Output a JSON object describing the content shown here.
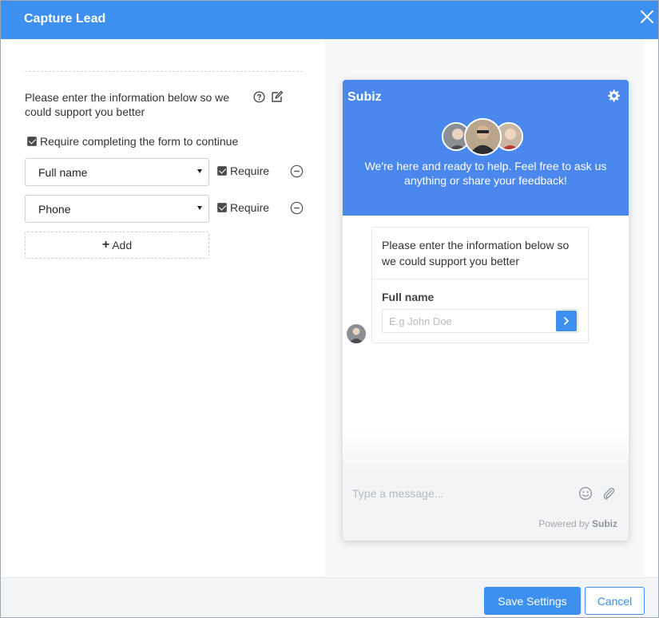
{
  "dialog": {
    "title": "Capture Lead",
    "close_icon": "close-icon"
  },
  "form": {
    "intro": "Please enter the information below so we could support you better",
    "require_label": "Require completing the form to continue",
    "require_checked": true,
    "fields": [
      {
        "value": "Full name",
        "require_label": "Require",
        "require_checked": true
      },
      {
        "value": "Phone",
        "require_label": "Require",
        "require_checked": true
      }
    ],
    "add_label": "Add"
  },
  "preview": {
    "brand": "Subiz",
    "welcome": "We're here and ready to help. Feel free to ask us anything or share your feedback!",
    "message": "Please enter the information below so we could support you better",
    "field_label": "Full name",
    "field_placeholder": "E.g John Doe",
    "composer_placeholder": "Type a message...",
    "powered_prefix": "Powered by",
    "powered_brand": "Subiz"
  },
  "footer": {
    "save_label": "Save Settings",
    "cancel_label": "Cancel"
  },
  "colors": {
    "primary": "#3d8ff0",
    "widget_header": "#4a88ee"
  }
}
